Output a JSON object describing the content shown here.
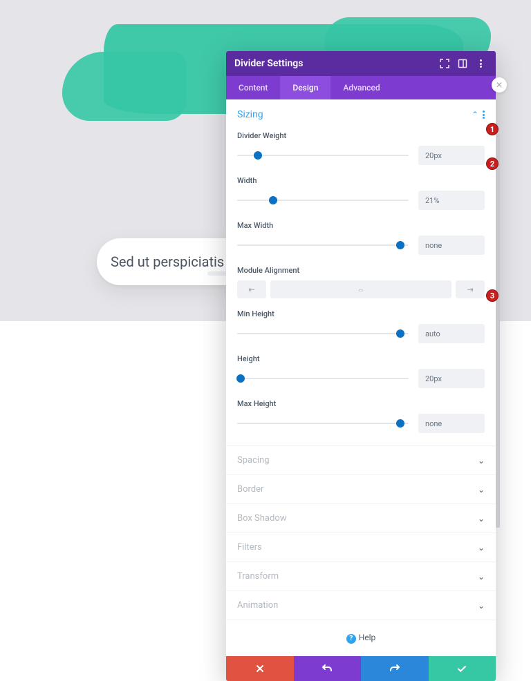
{
  "background": {
    "search_text": "Sed ut perspiciatis ur"
  },
  "modal": {
    "title": "Divider Settings",
    "tabs": {
      "content": "Content",
      "design": "Design",
      "advanced": "Advanced",
      "active": "Design"
    },
    "section_open": {
      "title": "Sizing",
      "fields": {
        "divider_weight": {
          "label": "Divider Weight",
          "value": "20px",
          "pos": 12
        },
        "width": {
          "label": "Width",
          "value": "21%",
          "pos": 21
        },
        "max_width": {
          "label": "Max Width",
          "value": "none",
          "pos": 95
        },
        "module_align": {
          "label": "Module Alignment"
        },
        "min_height": {
          "label": "Min Height",
          "value": "auto",
          "pos": 95
        },
        "height": {
          "label": "Height",
          "value": "20px",
          "pos": 2
        },
        "max_height": {
          "label": "Max Height",
          "value": "none",
          "pos": 95
        }
      }
    },
    "sections_collapsed": [
      "Spacing",
      "Border",
      "Box Shadow",
      "Filters",
      "Transform",
      "Animation"
    ],
    "help_label": "Help"
  },
  "annotations": {
    "b1": "1",
    "b2": "2",
    "b3": "3"
  }
}
